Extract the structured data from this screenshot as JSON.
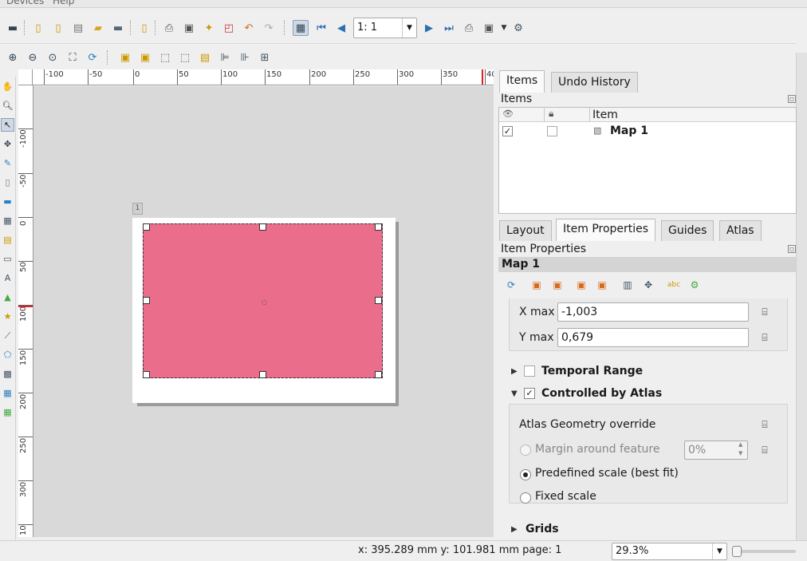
{
  "menubar": {
    "items": [
      "Devices",
      "Help"
    ]
  },
  "toolbar": {
    "zoom_value": "1: 1"
  },
  "ruler": {
    "h_labels": [
      "-100",
      "-50",
      "0",
      "50",
      "100",
      "150",
      "200",
      "250",
      "300",
      "350",
      "40"
    ],
    "v_labels": [
      "-100",
      "-50",
      "0",
      "50",
      "100",
      "150",
      "200",
      "250",
      "300",
      "10"
    ]
  },
  "canvas": {
    "page_number": "1",
    "map_fill_color": "#ea6e8c"
  },
  "panel": {
    "top_tabs": [
      "Items",
      "Undo History"
    ],
    "items_header": "Items",
    "items_column": "Item",
    "items_rows": [
      {
        "visible": "✓",
        "locked": "",
        "name": "Map 1"
      }
    ],
    "bottom_tabs": [
      "Layout",
      "Item Properties",
      "Guides",
      "Atlas"
    ],
    "props_header": "Item Properties",
    "item_name": "Map 1",
    "xmax_label": "X max",
    "xmax_value": "-1,003",
    "ymax_label": "Y max",
    "ymax_value": "0,679",
    "temporal_label": "Temporal Range",
    "atlas_group_label": "Controlled by Atlas",
    "atlas_check": "✓",
    "override_label": "Atlas Geometry override",
    "margin_label": "Margin around feature",
    "margin_value": "0%",
    "predefined_label": "Predefined scale (best fit)",
    "fixed_label": "Fixed scale",
    "grids_label": "Grids"
  },
  "status": {
    "coords": "x: 395.289 mm  y: 101.981 mm  page: 1",
    "zoom": "29.3%"
  }
}
